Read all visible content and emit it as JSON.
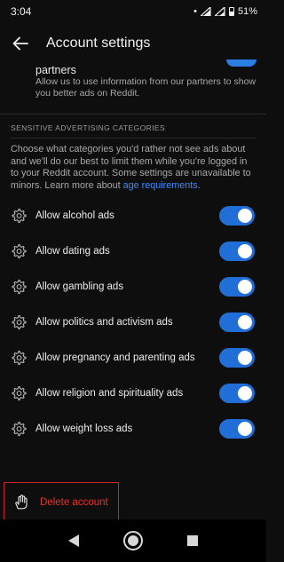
{
  "status_bar": {
    "time": "3:04",
    "indicator": "•",
    "battery": "51%"
  },
  "app_bar": {
    "title": "Account settings",
    "back_icon": "arrow-left-icon"
  },
  "partners": {
    "title": "partners",
    "description": "Allow us to use information from our partners to show you better ads on Reddit.",
    "enabled": true
  },
  "sensitive": {
    "header": "SENSITIVE ADVERTISING CATEGORIES",
    "description_before_link": "Choose what categories you'd rather not see ads about and we'll do our best to limit them while you're logged in to your Reddit account. Some settings are unavailable to minors. Learn more about ",
    "link_text": "age requirements",
    "description_after_link": ".",
    "items": [
      {
        "label": "Allow alcohol ads",
        "enabled": true
      },
      {
        "label": "Allow dating ads",
        "enabled": true
      },
      {
        "label": "Allow gambling ads",
        "enabled": true
      },
      {
        "label": "Allow politics and activism ads",
        "enabled": true
      },
      {
        "label": "Allow pregnancy and parenting ads",
        "enabled": true
      },
      {
        "label": "Allow religion and spirituality ads",
        "enabled": true
      },
      {
        "label": "Allow weight loss ads",
        "enabled": true
      }
    ]
  },
  "delete_account": {
    "label": "Delete account",
    "icon": "hand-wave-icon",
    "color": "#e8322a"
  },
  "colors": {
    "accent": "#1f6fd6",
    "link": "#3d8bfd",
    "danger": "#c8261e",
    "background": "#0e0e0e"
  },
  "nav_bar": {
    "icons": [
      "back-triangle-icon",
      "home-circle-icon",
      "recents-square-icon"
    ]
  }
}
